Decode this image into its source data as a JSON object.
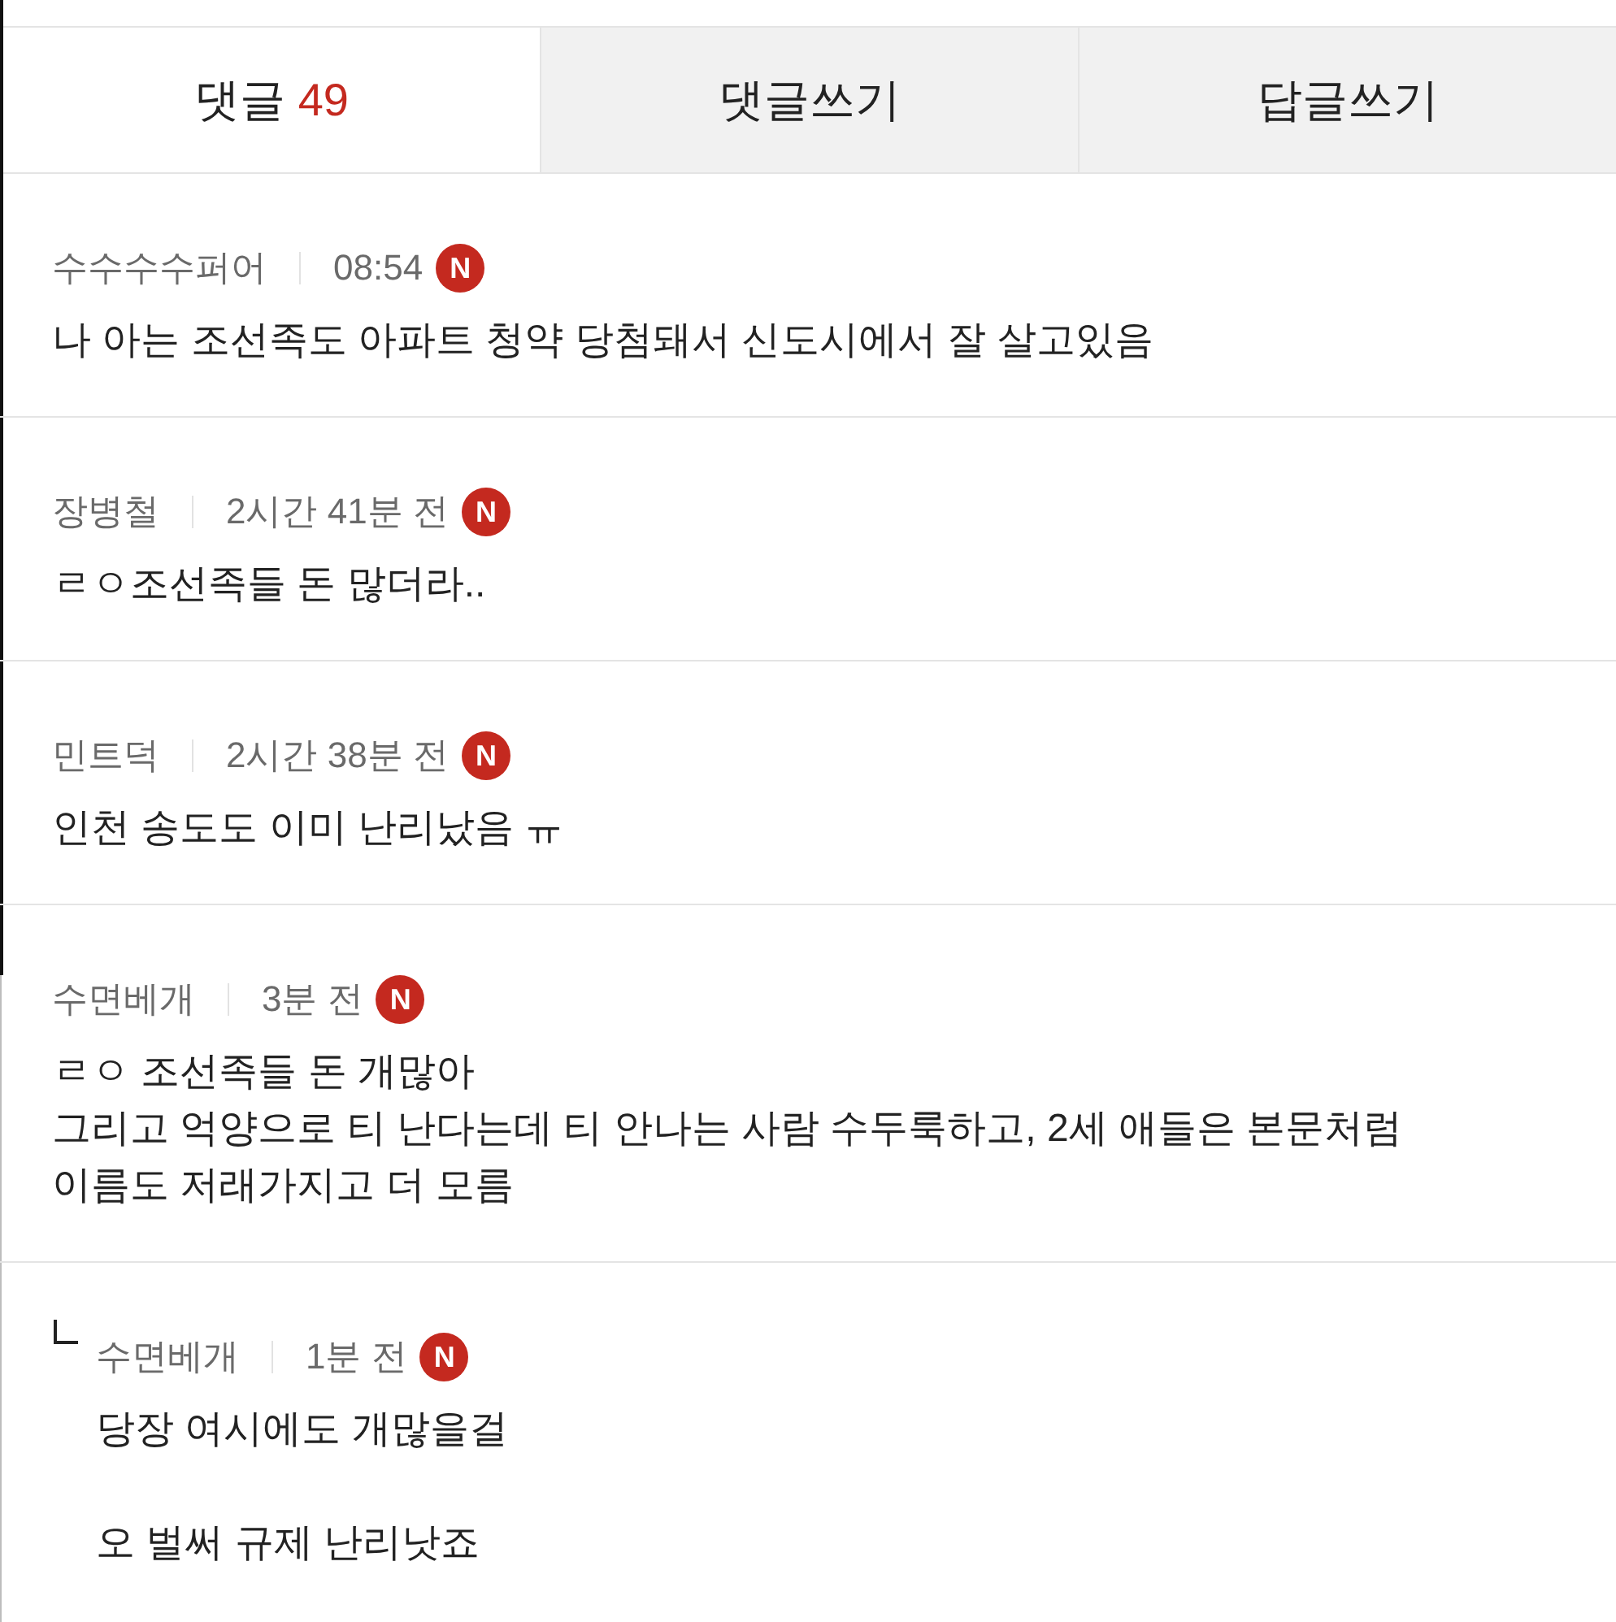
{
  "tabs": [
    {
      "label": "댓글",
      "count": "49",
      "selected": true
    },
    {
      "label": "댓글쓰기",
      "selected": false
    },
    {
      "label": "답글쓰기",
      "selected": false
    }
  ],
  "comments": [
    {
      "kind": "comment",
      "author": "수수수수퍼어",
      "time": "08:54",
      "badge": "N",
      "body": "나 아는 조선족도 아파트 청약 당첨돼서 신도시에서 잘 살고있음"
    },
    {
      "kind": "comment",
      "author": "장병철",
      "time": "2시간 41분 전",
      "badge": "N",
      "body": "ㄹㅇ조선족들 돈 많더라.."
    },
    {
      "kind": "comment",
      "author": "민트덕",
      "time": "2시간 38분 전",
      "badge": "N",
      "body": "인천 송도도 이미 난리났음 ㅠ"
    },
    {
      "kind": "comment",
      "author": "수면베개",
      "time": "3분 전",
      "badge": "N",
      "body": "ㄹㅇ 조선족들 돈 개많아\n그리고 억양으로 티 난다는데 티 안나는 사람 수두룩하고, 2세 애들은 본문처럼\n이름도 저래가지고 더 모름"
    },
    {
      "kind": "reply",
      "author": "수면베개",
      "time": "1분 전",
      "badge": "N",
      "body": "당장 여시에도 개많을걸\n\n오 벌써 규제 난리낫죠"
    }
  ]
}
